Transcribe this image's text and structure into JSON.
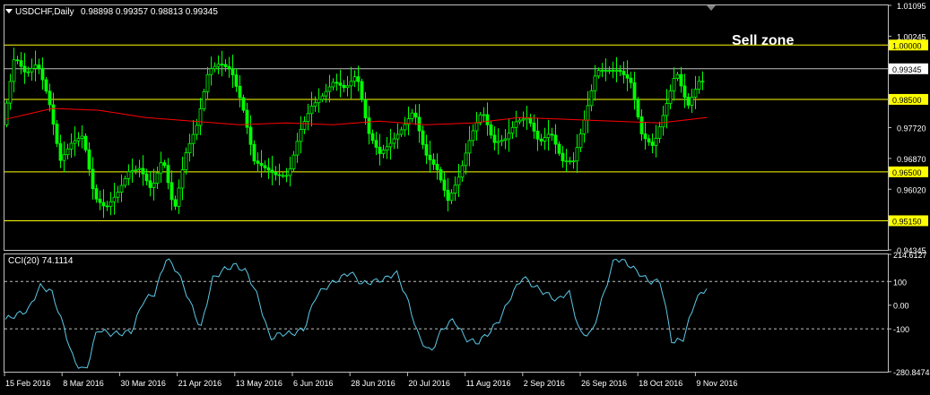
{
  "colors": {
    "background": "#000000",
    "frame": "#c0c0c0",
    "bull": "#00ff00",
    "bear": "#00ff00",
    "ma": "#ff0000",
    "level_line": "#ffff00",
    "current_line": "#c0c0c0",
    "cci": "#5bc8e6",
    "cci_levels": "#c0c0c0",
    "label_bg": "#ffff00",
    "label_text": "#000000",
    "text": "#ffffff"
  },
  "header": {
    "symbol": "USDCHF,Daily",
    "ohlc": "0.98898 0.99357 0.98813 0.99345"
  },
  "annotation": {
    "text": "Sell zone"
  },
  "chart_data": [
    {
      "type": "candlestick",
      "title": "USDCHF,Daily",
      "ylim": [
        0.94345,
        1.01095
      ],
      "y_ticks": [
        "1.01095",
        "1.00245",
        "0.99345",
        "0.97720",
        "0.96870",
        "0.96020",
        "0.94345"
      ],
      "x_ticks": [
        "15 Feb 2016",
        "8 Mar 2016",
        "30 Mar 2016",
        "21 Apr 2016",
        "13 May 2016",
        "6 Jun 2016",
        "28 Jun 2016",
        "20 Jul 2016",
        "11 Aug 2016",
        "2 Sep 2016",
        "26 Sep 2016",
        "18 Oct 2016",
        "9 Nov 2016"
      ],
      "horizontal_levels": [
        {
          "value": 1.0,
          "label": "1.00000"
        },
        {
          "value": 0.985,
          "label": "0.98500"
        },
        {
          "value": 0.965,
          "label": "0.96500"
        },
        {
          "value": 0.9515,
          "label": "0.95150"
        }
      ],
      "current_price": {
        "value": 0.99345,
        "label": "0.99345"
      },
      "moving_average_points": [
        0.9795,
        0.9825,
        0.982,
        0.98,
        0.979,
        0.978,
        0.9785,
        0.978,
        0.979,
        0.978,
        0.9785,
        0.98,
        0.9795,
        0.979,
        0.9785,
        0.98
      ],
      "price_path": [
        0.978,
        0.997,
        0.992,
        0.995,
        0.985,
        0.968,
        0.973,
        0.975,
        0.958,
        0.955,
        0.959,
        0.965,
        0.966,
        0.96,
        0.969,
        0.954,
        0.97,
        0.978,
        0.993,
        0.995,
        0.993,
        0.983,
        0.968,
        0.966,
        0.964,
        0.964,
        0.976,
        0.983,
        0.986,
        0.99,
        0.988,
        0.992,
        0.976,
        0.97,
        0.973,
        0.977,
        0.982,
        0.97,
        0.966,
        0.957,
        0.964,
        0.975,
        0.982,
        0.973,
        0.974,
        0.979,
        0.98,
        0.973,
        0.976,
        0.968,
        0.968,
        0.98,
        0.993,
        0.993,
        0.993,
        0.99,
        0.975,
        0.972,
        0.982,
        0.993,
        0.983,
        0.99
      ]
    },
    {
      "type": "line",
      "title": "CCI(20) 74.1114",
      "name": "CCI(20)",
      "ylim": [
        -280.8474,
        214.6127
      ],
      "y_ticks": [
        "214.6127",
        "100",
        "0.00",
        "-100",
        "-280.8474"
      ],
      "dashed_levels": [
        100,
        -100
      ],
      "values": [
        -60,
        -40,
        -20,
        80,
        60,
        -80,
        -240,
        -280,
        -100,
        -120,
        -120,
        -110,
        20,
        50,
        200,
        140,
        20,
        -100,
        110,
        150,
        170,
        140,
        30,
        -140,
        -120,
        -120,
        -100,
        40,
        80,
        110,
        140,
        90,
        100,
        110,
        140,
        20,
        -140,
        -200,
        -100,
        -60,
        -140,
        -160,
        -120,
        -60,
        40,
        120,
        80,
        50,
        20,
        60,
        -120,
        -120,
        40,
        200,
        180,
        140,
        100,
        100,
        -160,
        -140,
        20,
        74
      ]
    }
  ]
}
